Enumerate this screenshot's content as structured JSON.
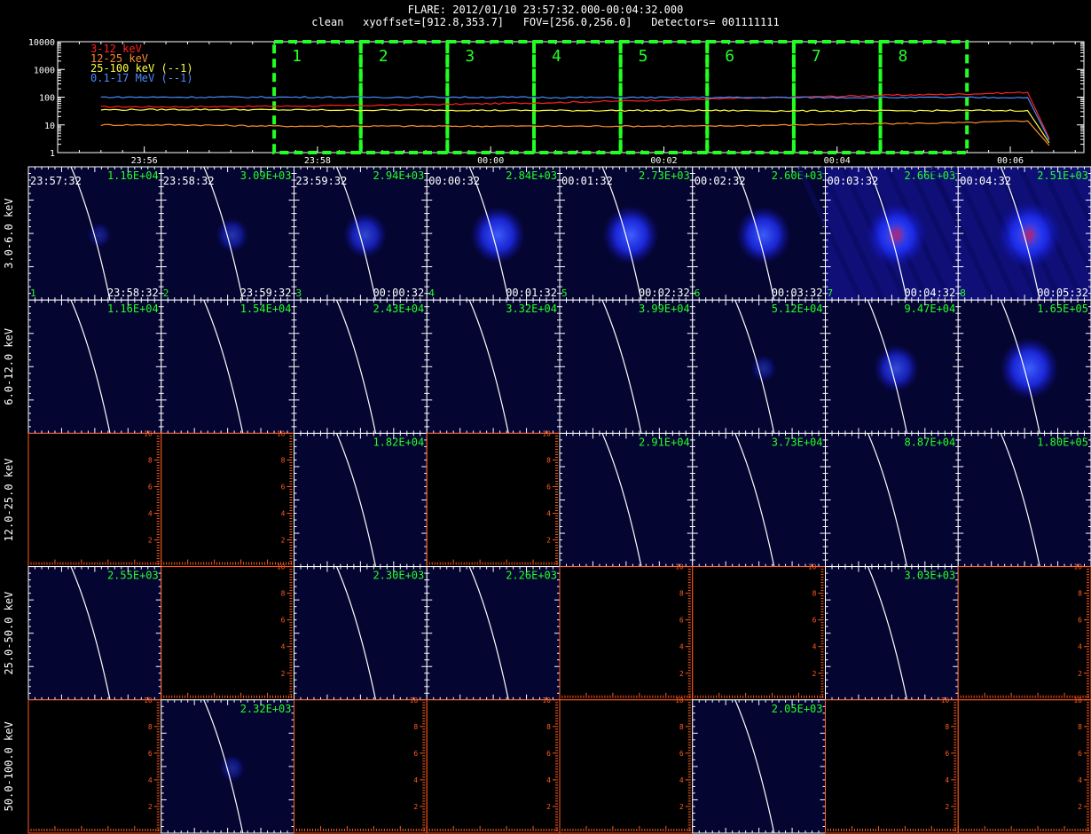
{
  "title": "FLARE: 2012/01/10 23:57:32.000-00:04:32.000",
  "subtitle": "clean   xyoffset=[912.8,353.7]   FOV=[256.0,256.0]   Detectors= 001111111",
  "colors": {
    "background": "#000000",
    "lightcurve_3_12": "#ff2020",
    "lightcurve_12_25": "#ff8c28",
    "lightcurve_25_100": "#ffff40",
    "lightcurve_01_17": "#4a8cff",
    "interval_box": "#22ff22",
    "panel_timestamp": "#ffffff",
    "panel_peak": "#22ff22",
    "panel_axis": "#ff5a1e",
    "image_background": "#050532",
    "limb_line": "#ffffff"
  },
  "chart_data": [
    {
      "type": "line",
      "title": "",
      "xlabel": "",
      "ylabel": "",
      "y_scale": "log",
      "ylim": [
        1,
        10000
      ],
      "x_ticks": [
        "23:56",
        "23:58",
        "00:00",
        "00:02",
        "00:04",
        "00:06"
      ],
      "y_ticks": [
        "1",
        "10",
        "100",
        "1000",
        "10000"
      ],
      "x_minutes_from_2355": [
        0.5,
        1.5,
        2.5,
        3.5,
        4.5,
        5.5,
        6.5,
        7.5,
        8.5,
        9.5,
        10.5,
        11.2,
        11.5
      ],
      "series": [
        {
          "name": "3-12 keV",
          "color": "#ff2020",
          "values": [
            45,
            45,
            47,
            50,
            55,
            62,
            72,
            85,
            100,
            115,
            130,
            150,
            1.5
          ]
        },
        {
          "name": "12-25 keV",
          "color": "#ff8c28",
          "values": [
            10,
            10,
            9,
            9,
            9,
            9,
            9,
            9,
            10,
            11,
            12,
            14,
            1.2
          ]
        },
        {
          "name": "25-100 keV (--1)",
          "color": "#ffff40",
          "values": [
            35,
            36,
            35,
            34,
            34,
            33,
            33,
            33,
            32,
            32,
            33,
            33,
            1.3
          ]
        },
        {
          "name": "0.1-17 MeV (--1)",
          "color": "#4a8cff",
          "values": [
            100,
            100,
            100,
            100,
            100,
            98,
            97,
            97,
            97,
            97,
            97,
            97,
            1.4
          ]
        }
      ],
      "intervals": [
        "1",
        "2",
        "3",
        "4",
        "5",
        "6",
        "7",
        "8"
      ]
    },
    {
      "type": "heatmap",
      "energy_bands": [
        "3.0-6.0 keV",
        "6.0-12.0 keV",
        "12.0-25.0 keV",
        "25.0-50.0 keV",
        "50.0-100.0 keV"
      ],
      "time_bins": [
        "1",
        "2",
        "3",
        "4",
        "5",
        "6",
        "7",
        "8"
      ],
      "start_times": [
        "23:57:32",
        "23:58:32",
        "23:59:32",
        "00:00:32",
        "00:01:32",
        "00:02:32",
        "00:03:32",
        "00:04:32"
      ],
      "end_times": [
        "23:58:32",
        "23:59:32",
        "00:00:32",
        "00:01:32",
        "00:02:32",
        "00:03:32",
        "00:04:32",
        "00:05:32"
      ],
      "peak_values": [
        [
          "1.16E+04",
          "3.09E+03",
          "2.94E+03",
          "2.84E+03",
          "2.73E+03",
          "2.60E+03",
          "2.66E+03",
          "2.51E+03"
        ],
        [
          "1.16E+04",
          "1.54E+04",
          "2.43E+04",
          "3.32E+04",
          "3.99E+04",
          "5.12E+04",
          "9.47E+04",
          "1.65E+05"
        ],
        [
          "",
          "",
          "1.82E+04",
          "",
          "2.91E+04",
          "3.73E+04",
          "8.87E+04",
          "1.80E+05"
        ],
        [
          "2.55E+03",
          "",
          "2.30E+03",
          "2.26E+03",
          "",
          "",
          "3.03E+03",
          ""
        ],
        [
          "",
          "2.32E+03",
          "",
          "",
          "",
          "2.05E+03",
          "",
          ""
        ]
      ],
      "has_image": [
        [
          true,
          true,
          true,
          true,
          true,
          true,
          true,
          true
        ],
        [
          true,
          true,
          true,
          true,
          true,
          true,
          true,
          true
        ],
        [
          false,
          false,
          true,
          false,
          true,
          true,
          true,
          true
        ],
        [
          true,
          false,
          true,
          true,
          false,
          false,
          true,
          false
        ],
        [
          false,
          true,
          false,
          false,
          false,
          true,
          false,
          false
        ]
      ],
      "source_intensity": [
        [
          0.05,
          0.22,
          0.42,
          0.62,
          0.65,
          0.62,
          0.75,
          0.8
        ],
        [
          0.0,
          0.0,
          0.0,
          0.0,
          0.0,
          0.08,
          0.45,
          0.7
        ],
        [
          0.0,
          0.0,
          0.0,
          0.0,
          0.0,
          0.0,
          0.0,
          0.0
        ],
        [
          0.0,
          0.0,
          0.0,
          0.0,
          0.0,
          0.0,
          0.0,
          0.0
        ],
        [
          0.0,
          0.08,
          0.0,
          0.0,
          0.0,
          0.0,
          0.0,
          0.0
        ]
      ],
      "empty_axis_ticks": [
        "2",
        "4",
        "6",
        "8",
        "10"
      ]
    }
  ]
}
